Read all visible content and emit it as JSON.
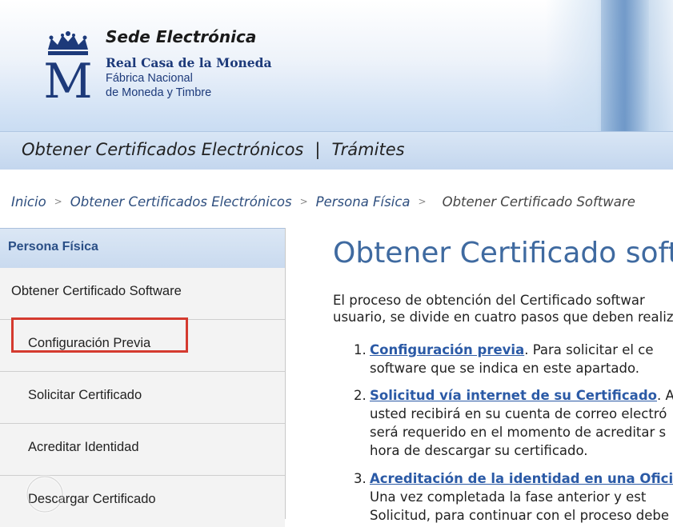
{
  "header": {
    "brand_title": "Sede Electrónica",
    "brand_sub1": "Real Casa de la Moneda",
    "brand_sub2": "Fábrica Nacional",
    "brand_sub3": "de Moneda y Timbre",
    "nav_left": "Obtener Certificados Electrónicos",
    "nav_sep": "|",
    "nav_right": "Trámites"
  },
  "breadcrumb": {
    "items": [
      "Inicio",
      "Obtener Certificados Electrónicos",
      "Persona Física"
    ],
    "current": "Obtener Certificado Software",
    "separator": ">"
  },
  "sidebar": {
    "heading": "Persona Física",
    "items": [
      {
        "label": "Obtener Certificado Software",
        "level": "top"
      },
      {
        "label": "Configuración Previa",
        "level": "sub"
      },
      {
        "label": "Solicitar Certificado",
        "level": "sub"
      },
      {
        "label": "Acreditar Identidad",
        "level": "sub"
      },
      {
        "label": "Descargar Certificado",
        "level": "sub"
      }
    ]
  },
  "main": {
    "title": "Obtener Certificado softw",
    "intro_line1": "El proceso de obtención del Certificado softwar",
    "intro_line2": "usuario, se divide en cuatro pasos que deben realiza",
    "steps": [
      {
        "num": "1.",
        "link": "Configuración previa",
        "rest1": ". Para solicitar el ce",
        "line2": "software que se indica en este apartado."
      },
      {
        "num": "2.",
        "link": "Solicitud vía internet de su Certificado",
        "rest1": ". A",
        "line2": "usted recibirá en su cuenta de correo electró",
        "line3": "será requerido en el momento de acreditar s",
        "line4": "hora de descargar su certificado."
      },
      {
        "num": "3.",
        "link": "Acreditación de la identidad en una Oficir",
        "rest1": "",
        "line2": "Una vez completada la fase anterior y est",
        "line3": "Solicitud, para continuar con el proceso debe"
      }
    ]
  },
  "colors": {
    "accent_title": "#3f6aa0",
    "link": "#2b5aa6",
    "highlight": "#d43a2f"
  }
}
